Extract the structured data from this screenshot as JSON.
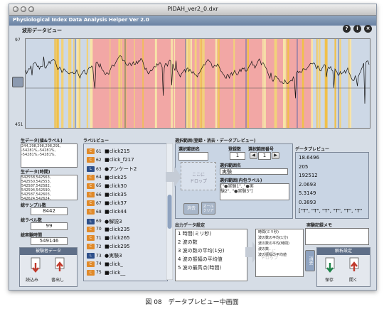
{
  "window": {
    "title": "PIDAH_ver2_0.dxr"
  },
  "app": {
    "title": "Physiological Index Data Analysis Helper Ver 2.0"
  },
  "header_icons": [
    "help-icon",
    "info-icon",
    "close-icon"
  ],
  "waveform": {
    "label": "波形データビュー",
    "y_top": "97",
    "y_mid": "0",
    "y_bottom": "451"
  },
  "raw_label_data": {
    "label": "生データ(値&ラベル)",
    "text": "244,298,298,298,291,\n-54281%,-54281%,\n-54281%,-54281%,"
  },
  "raw_time_data": {
    "label": "生データ(時間)",
    "text": "542558,542563,\n542550,542553,\n542587,542582,\n542594,542590,\n542587,542603,\n542624,542624,"
  },
  "stats": {
    "total_samples_label": "総サンプル数",
    "total_samples": "8442",
    "total_labels_label": "総ラベル数",
    "total_labels": "99",
    "total_time_label": "総実験時間",
    "total_time": "549146"
  },
  "subject_data": {
    "label": "被験者データ",
    "load": "読込み",
    "export": "書出し"
  },
  "label_view": {
    "label": "ラベルビュー",
    "rows": [
      {
        "badge": "C",
        "num": "61",
        "text": "■click215"
      },
      {
        "badge": "C",
        "num": "62",
        "text": "■click_f217"
      },
      {
        "badge": "L",
        "num": "63",
        "text": "●アンケート2"
      },
      {
        "badge": "C",
        "num": "64",
        "text": "■click25"
      },
      {
        "badge": "C",
        "num": "65",
        "text": "■click30"
      },
      {
        "badge": "C",
        "num": "66",
        "text": "■click35"
      },
      {
        "badge": "C",
        "num": "67",
        "text": "■click37"
      },
      {
        "badge": "C",
        "num": "68",
        "text": "■click44"
      },
      {
        "badge": "L",
        "num": "69",
        "text": "●解説3"
      },
      {
        "badge": "C",
        "num": "70",
        "text": "■click235"
      },
      {
        "badge": "C",
        "num": "71",
        "text": "■click265"
      },
      {
        "badge": "C",
        "num": "72",
        "text": "■click295"
      },
      {
        "badge": "L",
        "num": "73",
        "text": "●実験3"
      },
      {
        "badge": "C",
        "num": "74",
        "text": "■click_"
      },
      {
        "badge": "C",
        "num": "75",
        "text": "■click__"
      }
    ]
  },
  "selection": {
    "label": "選択範囲(登録・消去・データプレビュー)",
    "name_label": "選択範囲名",
    "count_label": "登録数",
    "count": "1",
    "number_label": "選択範囲番号",
    "number": "1",
    "drop_hint": "ここに\nドロップ",
    "range_name_label": "選択範囲名",
    "range_name": "実験",
    "inner_label_label": "選択範囲(内包ラベル)",
    "inner_labels": "[\"●実験1\", \"●実\n験2\", \"●実験3\"]",
    "delete_btn": "消去",
    "clear_btn": "オール\nクリア"
  },
  "data_preview": {
    "label": "データプレビュー",
    "values": [
      "18.6496",
      "205",
      "192512",
      "2.0693",
      "5.3149",
      "0.3893",
      "[\"T\", \"T\", \"T\", \"T\", \"T\", \"T\""
    ]
  },
  "output_settings": {
    "label": "出力データ設定",
    "items": [
      "1  時間(ミリ秒)",
      "2  波の数",
      "3  波の数の平均(1分)",
      "4  波の振幅の平均値",
      "5  波の最高点(時間)"
    ],
    "selected": [
      "時間(ミリ秒)",
      "波の数の平均(1分)",
      "波の数の平均(時間)",
      "波の数",
      "波の振幅の平均値"
    ],
    "drop_hint": "ここに\nドロップ",
    "delete_btn": "消去"
  },
  "memo": {
    "label": "実験記録メモ"
  },
  "analysis": {
    "label": "解析設定",
    "save": "保存",
    "open": "開く"
  },
  "caption": "図 08　データプレビュー中画面"
}
